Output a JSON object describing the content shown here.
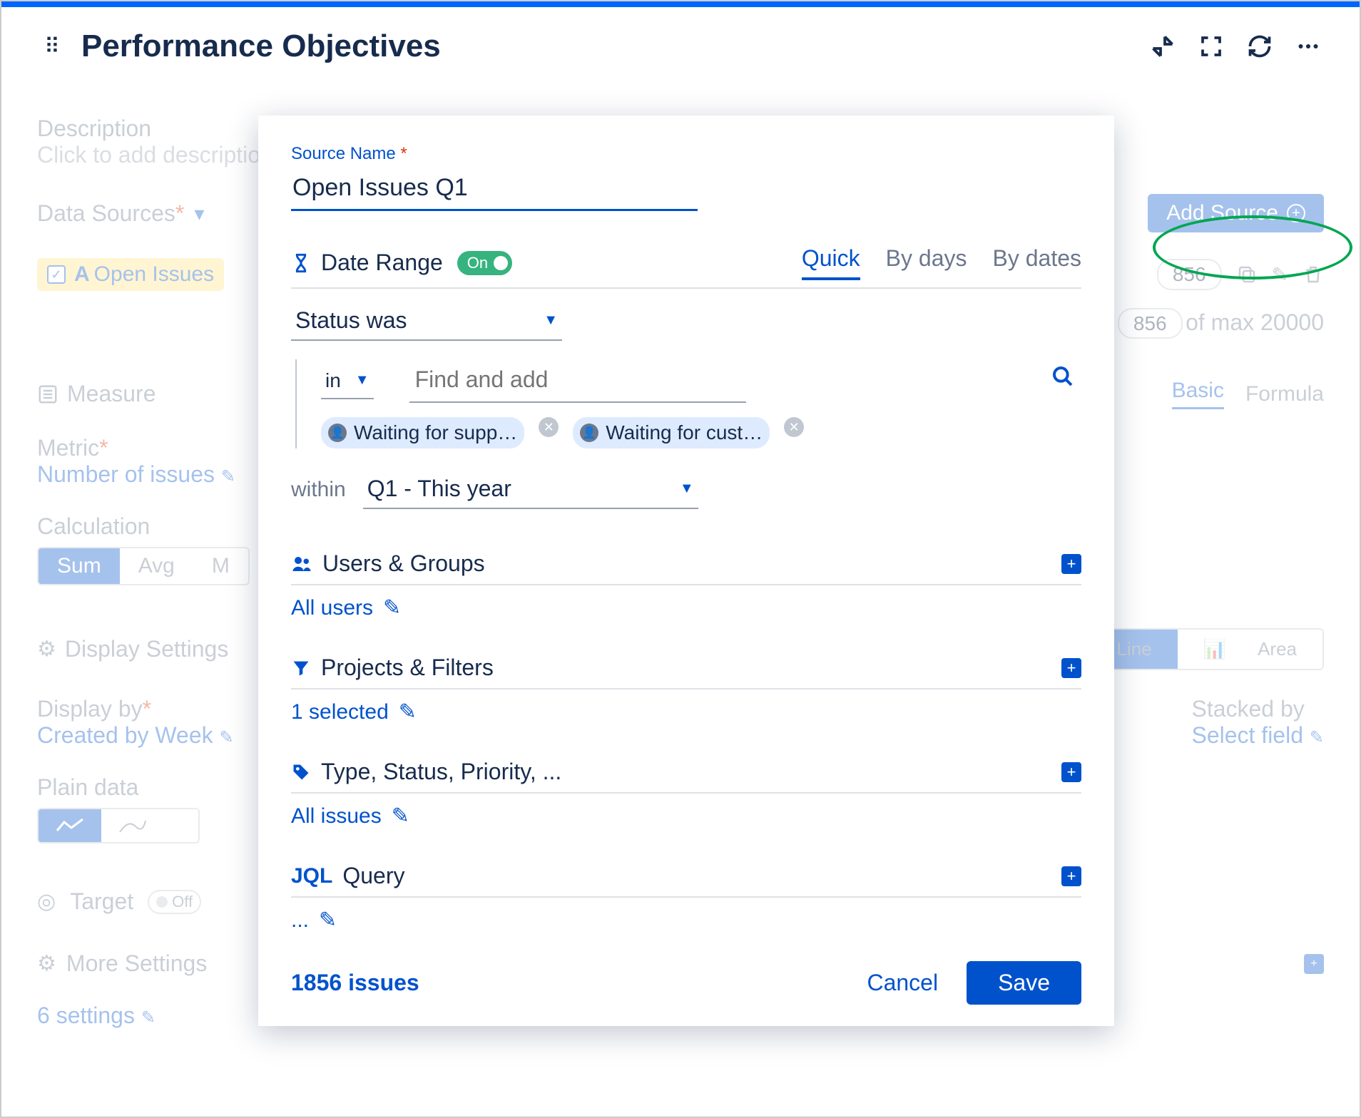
{
  "header": {
    "title": "Performance Objectives"
  },
  "bg": {
    "description_label": "Description",
    "description_placeholder": "Click to add description",
    "data_sources_label": "Data Sources",
    "add_source_btn": "Add Source",
    "source_chip": "Open Issues",
    "count1": "856",
    "count2": "856",
    "of_max": " of max 20000",
    "measure": "Measure",
    "tab_basic": "Basic",
    "tab_formula": "Formula",
    "metric_label": "Metric",
    "metric_value": "Number of issues",
    "calc_label": "Calculation",
    "calc_sum": "Sum",
    "calc_avg": "Avg",
    "calc_ma": "M",
    "display_settings": "Display Settings",
    "line": "Line",
    "area": "Area",
    "display_by_label": "Display by",
    "display_by_value": "Created by Week",
    "stacked_by_label": "Stacked by",
    "stacked_by_value": "Select field",
    "plain_data": "Plain data",
    "target": "Target",
    "off": "Off",
    "more_settings": "More Settings",
    "settings_count": "6 settings"
  },
  "modal": {
    "source_name_label": "Source Name",
    "source_name_value": "Open Issues Q1",
    "date_range": "Date Range",
    "on": "On",
    "tab_quick": "Quick",
    "tab_by_days": "By days",
    "tab_by_dates": "By dates",
    "status_was": "Status was",
    "in": "in",
    "find_placeholder": "Find and add",
    "chip1": "Waiting for supp…",
    "chip2": "Waiting for cust…",
    "within": "within",
    "within_value": "Q1 - This year",
    "users_groups": "Users & Groups",
    "users_value": "All users",
    "projects_filters": "Projects & Filters",
    "projects_value": "1 selected",
    "type_status": "Type, Status, Priority, ...",
    "type_value": "All issues",
    "jql": "JQL",
    "query": "Query",
    "jql_value": "...",
    "issue_count": "1856 issues",
    "cancel": "Cancel",
    "save": "Save"
  }
}
